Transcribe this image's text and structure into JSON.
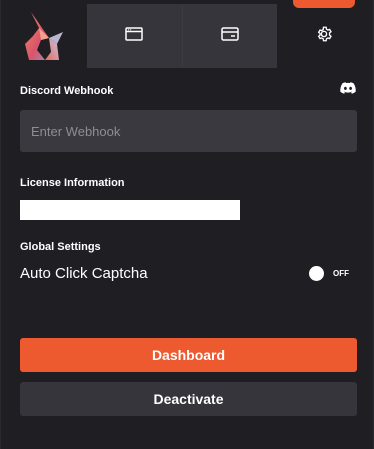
{
  "colors": {
    "accent": "#ee5a30",
    "background": "#1f1e23",
    "panel": "#36353b",
    "input_bg": "#3a3940"
  },
  "nav": {
    "logo_icon": "fox-mascot-logo",
    "tabs": [
      {
        "icon": "browser-window-icon"
      },
      {
        "icon": "credit-card-icon"
      }
    ],
    "settings_icon": "gear-icon"
  },
  "webhook": {
    "label": "Discord Webhook",
    "placeholder": "Enter Webhook",
    "value": "",
    "discord_icon": "discord-icon"
  },
  "license": {
    "label": "License Information",
    "value": ""
  },
  "global_settings": {
    "label": "Global Settings",
    "auto_click_captcha": {
      "label": "Auto Click Captcha",
      "state": "OFF",
      "enabled": false
    }
  },
  "actions": {
    "dashboard_label": "Dashboard",
    "deactivate_label": "Deactivate"
  }
}
